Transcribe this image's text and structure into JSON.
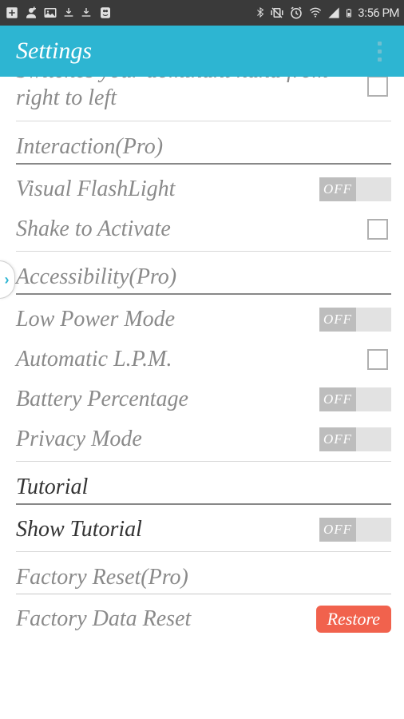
{
  "status": {
    "time": "3:56 PM"
  },
  "header": {
    "title": "Settings"
  },
  "rows": {
    "hand_switch_desc": "Switches your dominant hand from right to left"
  },
  "sections": {
    "interaction": {
      "title": "Interaction(Pro)",
      "visual_flashlight": {
        "label": "Visual FlashLight",
        "toggle": "OFF"
      },
      "shake": {
        "label": "Shake to Activate"
      }
    },
    "accessibility": {
      "title": "Accessibility(Pro)",
      "low_power": {
        "label": "Low Power Mode",
        "toggle": "OFF"
      },
      "auto_lpm": {
        "label": "Automatic L.P.M."
      },
      "battery": {
        "label": "Battery Percentage",
        "toggle": "OFF"
      },
      "privacy": {
        "label": "Privacy Mode",
        "toggle": "OFF"
      }
    },
    "tutorial": {
      "title": "Tutorial",
      "show": {
        "label": "Show Tutorial",
        "toggle": "OFF"
      }
    },
    "factory": {
      "title": "Factory Reset(Pro)",
      "reset": {
        "label": "Factory Data Reset",
        "button": "Restore"
      }
    }
  }
}
